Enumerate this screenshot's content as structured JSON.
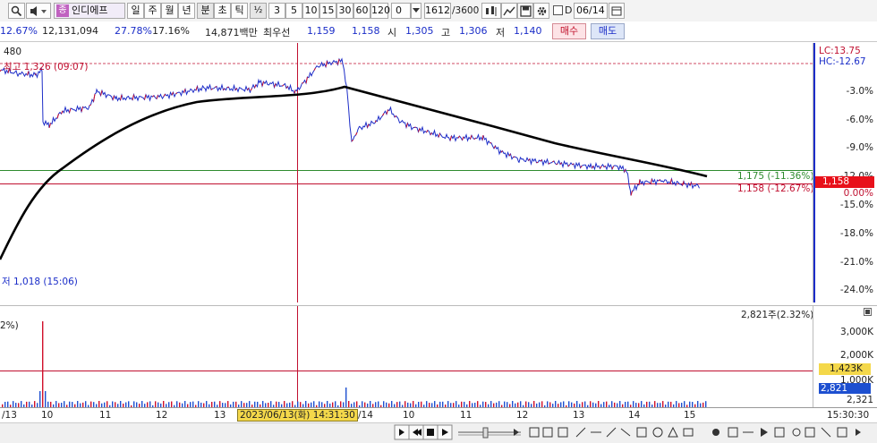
{
  "toolbar": {
    "stock_name": "인디에프",
    "period_buttons": [
      "일",
      "주",
      "월",
      "년",
      "분",
      "초",
      "틱"
    ],
    "half": "½",
    "minute_buttons": [
      "3",
      "5",
      "10",
      "15",
      "30",
      "60",
      "120"
    ],
    "count_value": "0",
    "page_value": "1612",
    "page_total": "/3600",
    "checkbox_label": "D",
    "date_value": "06/14"
  },
  "quote": {
    "change_pct": "12.67%",
    "volume": "12,131,094",
    "vol_ratio": "27.78%",
    "turnover": "17.16%",
    "amount": "14,871백만",
    "best_label": "최우선",
    "ask": "1,159",
    "bid": "1,158",
    "open_label": "시",
    "open": "1,305",
    "high_label": "고",
    "high": "1,306",
    "low_label": "저",
    "low": "1,140",
    "buy_button": "매수",
    "sell_button": "매도"
  },
  "chart": {
    "top_left": "480",
    "high_note": "최고 1,326 (09:07)",
    "low_note": "저 1,018 (15:06)",
    "lc": "LC:13.75",
    "hc": "HC:-12.67",
    "green_line_label": "1,175 (-11.36%)",
    "red_line_label": "1,158 (-12.67%)",
    "current_price": "1,158",
    "zero_pct": "0.00%",
    "y_ticks": [
      "-3.0%",
      "-6.0%",
      "-9.0%",
      "-12.0%",
      "-15.0%",
      "-18.0%",
      "-21.0%",
      "-24.0%"
    ],
    "vol_note": "2,821주(2.32%)",
    "vol_left_note": "2%)",
    "vol_ticks": [
      "3,000K",
      "2,000K",
      "1,000K"
    ],
    "vol_ref_value": "1,423K",
    "vol_current": "2,821",
    "vol_bottom": "2,321",
    "x_labels": [
      "/13",
      "10",
      "11",
      "12",
      "13",
      "/14",
      "10",
      "11",
      "12",
      "13",
      "14",
      "15"
    ],
    "crosshair_time": "2023/06/13(화) 14:31:30",
    "right_time": "15:30:30"
  },
  "colors": {
    "up": "#d0102a",
    "down": "#1d2dc8",
    "ma": "#000000",
    "ref_green": "#2e8b2e",
    "ref_red": "#c01030",
    "current_bg": "#e8101a",
    "vol_blue": "#1d4fd0",
    "vol_ref_bg": "#f4d84a"
  }
}
